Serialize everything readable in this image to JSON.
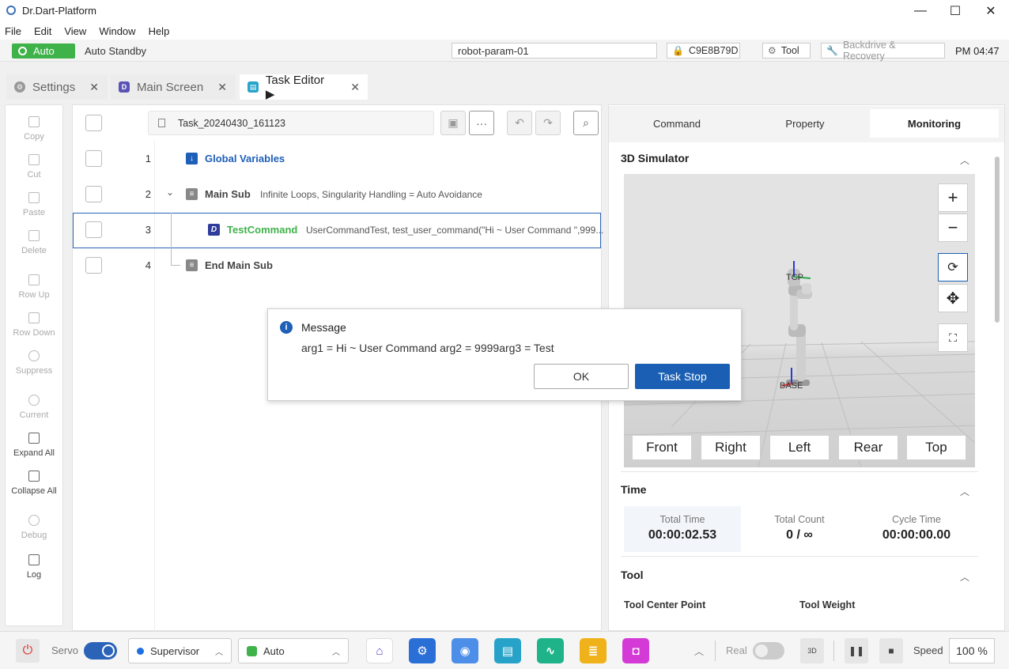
{
  "window": {
    "title": "Dr.Dart-Platform",
    "minimize": "—",
    "maximize": "☐",
    "close": "✕"
  },
  "menu": [
    "File",
    "Edit",
    "View",
    "Window",
    "Help"
  ],
  "status": {
    "mode": "Auto",
    "state": "Auto Standby",
    "robot_param": "robot-param-01",
    "id": "C9E8B79D",
    "tool": "Tool",
    "backdrive": "Backdrive & Recovery",
    "clock": "PM 04:47"
  },
  "tabs": [
    {
      "label": "Settings",
      "close": "✕"
    },
    {
      "label": "Main Screen",
      "close": "✕"
    },
    {
      "label": "Task Editor ▶",
      "close": "✕"
    }
  ],
  "left_tools": [
    "Copy",
    "Cut",
    "Paste",
    "Delete",
    "Row Up",
    "Row Down",
    "Suppress",
    "Current",
    "Expand All",
    "Collapse All",
    "Debug",
    "Log"
  ],
  "editor": {
    "task_name": "Task_20240430_161123",
    "more_icon": "···",
    "rows": [
      {
        "num": "1",
        "title": "Global Variables",
        "desc": ""
      },
      {
        "num": "2",
        "title": "Main Sub",
        "desc": "Infinite Loops, Singularity Handling = Auto Avoidance"
      },
      {
        "num": "3",
        "title": "TestCommand",
        "desc": "UserCommandTest, test_user_command(\"Hi ~ User Command \",999..."
      },
      {
        "num": "4",
        "title": "End Main Sub",
        "desc": ""
      }
    ]
  },
  "dialog": {
    "title": "Message",
    "message": "arg1 = Hi ~ User Command arg2 = 9999arg3 = Test",
    "ok": "OK",
    "stop": "Task Stop"
  },
  "right_panel": {
    "tabs": [
      "Command",
      "Property",
      "Monitoring"
    ],
    "sim_title": "3D Simulator",
    "zoom_in": "+",
    "zoom_out": "−",
    "tcp_label": "TCP",
    "base_label": "BASE",
    "views": [
      "Front",
      "Right",
      "Left",
      "Rear",
      "Top"
    ],
    "time_title": "Time",
    "total_time_label": "Total Time",
    "total_time": "00:00:02.53",
    "total_count_label": "Total Count",
    "total_count": "0 / ∞",
    "cycle_time_label": "Cycle Time",
    "cycle_time": "00:00:00.00",
    "tool_title": "Tool",
    "tcp_field": "Tool Center Point",
    "weight_field": "Tool Weight"
  },
  "bottom": {
    "servo": "Servo",
    "role": "Supervisor",
    "mode": "Auto",
    "real": "Real",
    "speed_label": "Speed",
    "speed": "100 %",
    "badge_3d": "3D"
  },
  "colors": {
    "accent": "#1a5fb4",
    "auto_green": "#3fb24a",
    "cmd_green": "#3fb24a",
    "var_blue": "#1e5fb8"
  }
}
